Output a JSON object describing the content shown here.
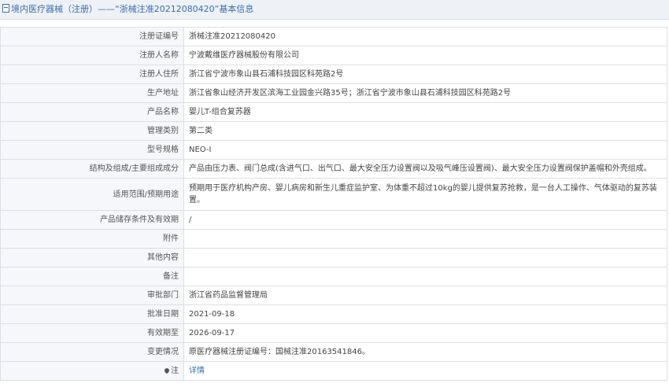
{
  "header": {
    "title": "境内医疗器械（注册）——“浙械注准20212080420”基本信息"
  },
  "rows": [
    {
      "label": "注册证编号",
      "value": "浙械注准20212080420"
    },
    {
      "label": "注册人名称",
      "value": "宁波戴维医疗器械股份有限公司"
    },
    {
      "label": "注册人住所",
      "value": "浙江省宁波市象山县石浦科技园区科苑路2号"
    },
    {
      "label": "生产地址",
      "value": "浙江省象山经济开发区滨海工业园金兴路35号；浙江省宁波市象山县石浦科技园区科苑路2号"
    },
    {
      "label": "产品名称",
      "value": "婴儿T-组合复苏器"
    },
    {
      "label": "管理类别",
      "value": "第二类"
    },
    {
      "label": "型号规格",
      "value": "NEO-Ⅰ"
    },
    {
      "label": "结构及组成/主要组成成分",
      "value": "产品由压力表、阀门总成(含进气口、出气口、最大安全压力设置阀以及吸气峰压设置阀)、最大安全压力设置阀保护盖帽和外壳组成。"
    },
    {
      "label": "适用范围/预期用途",
      "value": "预期用于医疗机构产房、婴儿病房和新生儿重症监护室、为体重不超过10kg的婴儿提供复苏抢救，是一台人工操作、气体驱动的复苏装置。"
    },
    {
      "label": "产品储存条件及有效期",
      "value": "/"
    },
    {
      "label": "附件",
      "value": ""
    },
    {
      "label": "其他内容",
      "value": ""
    },
    {
      "label": "备注",
      "value": ""
    },
    {
      "label": "审批部门",
      "value": "浙江省药品监督管理局"
    },
    {
      "label": "批准日期",
      "value": "2021-09-18"
    },
    {
      "label": "有效期至",
      "value": "2026-09-17"
    },
    {
      "label": "变更情况",
      "value": "原医疗器械注册证编号：国械注准20163541846。"
    },
    {
      "label": "注",
      "value": "详情"
    }
  ]
}
